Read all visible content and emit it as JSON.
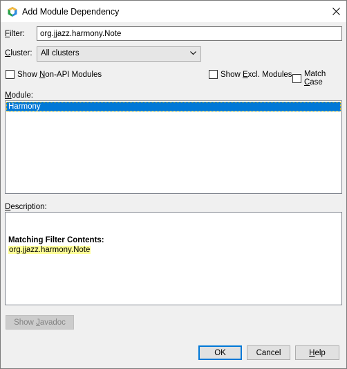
{
  "window": {
    "title": "Add Module Dependency",
    "close_label": "✕"
  },
  "filter": {
    "label_prefix": "",
    "label_accel": "F",
    "label_rest": "ilter:",
    "value": "org.jjazz.harmony.Note"
  },
  "cluster": {
    "label_accel": "C",
    "label_rest": "luster:",
    "selected": "All clusters"
  },
  "options": {
    "non_api": {
      "pre": "Show ",
      "accel": "N",
      "post": "on-API Modules",
      "checked": false
    },
    "excl": {
      "pre": "Show ",
      "accel": "E",
      "post": "xcl. Modules",
      "checked": false
    },
    "match_case": {
      "pre": "Match ",
      "accel": "C",
      "post": "ase",
      "checked": false
    }
  },
  "module": {
    "label_accel": "M",
    "label_rest": "odule:",
    "items": [
      "Harmony"
    ],
    "selected_index": 0
  },
  "description": {
    "label_accel": "D",
    "label_rest": "escription:",
    "heading": "Matching Filter Contents:",
    "match": "org.jjazz.harmony.Note"
  },
  "buttons": {
    "javadoc": {
      "pre": "Show ",
      "accel": "J",
      "post": "avadoc",
      "enabled": false
    },
    "ok": "OK",
    "cancel": "Cancel",
    "help": {
      "accel": "H",
      "post": "elp"
    }
  }
}
